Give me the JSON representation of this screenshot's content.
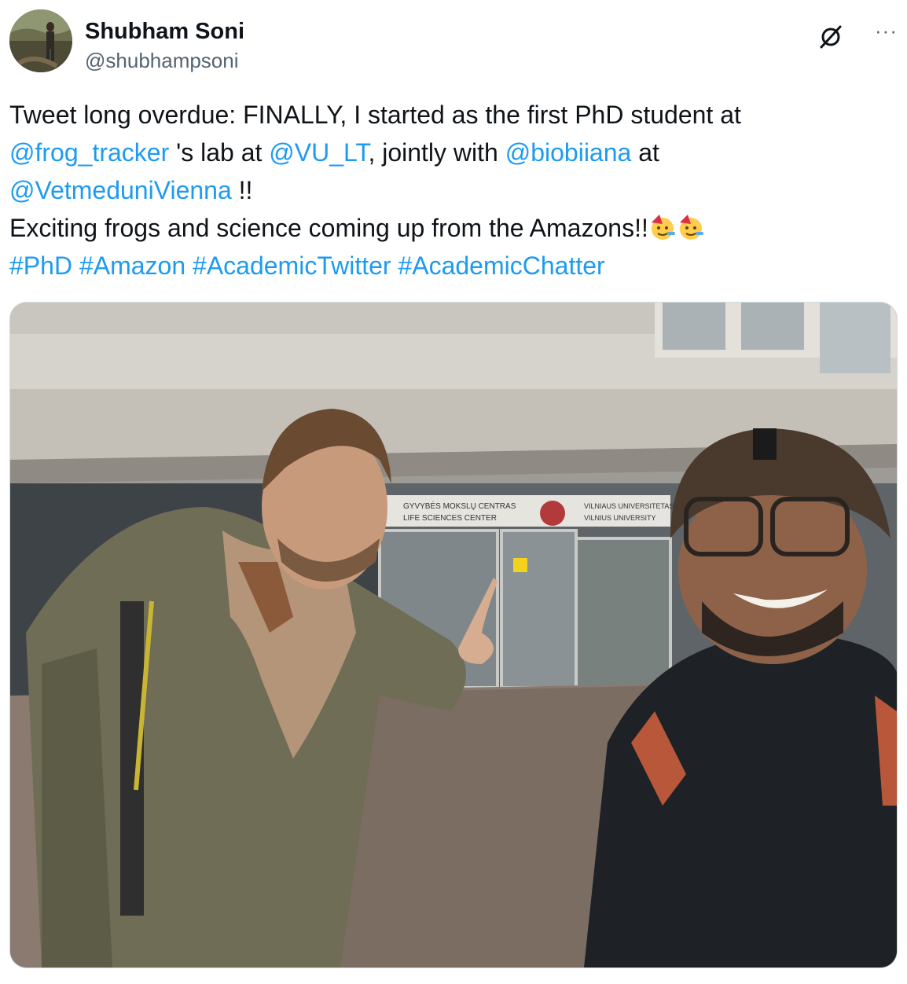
{
  "author": {
    "name": "Shubham Soni",
    "handle": "@shubhampsoni",
    "avatar_icon": "avatar-photo"
  },
  "actions": {
    "grok_icon": "grok-icon",
    "more_label": "···"
  },
  "tweet": {
    "line1": "Tweet long overdue: FINALLY, I started as the first PhD student at",
    "mention_frog": "@frog_tracker",
    "line2_mid1": " 's lab at ",
    "mention_vu": "@VU_LT",
    "line2_mid2": ", jointly with ",
    "mention_bio": "@biobiiana",
    "line2_end": " at",
    "mention_vet": "@VetmeduniVienna",
    "line3_end": " !!",
    "line4": "Exciting frogs and science coming up from the Amazons!!",
    "hashtags": [
      "#PhD",
      "#Amazon",
      "#AcademicTwitter",
      "#AcademicChatter"
    ]
  },
  "colors": {
    "link": "#1d9bf0",
    "text": "#0f1419",
    "muted": "#536471",
    "border": "#cfd9de"
  },
  "media": {
    "photo_icon": "selfie-photo",
    "sign_line1": "GYVYBĖS MOKSLŲ CENTRAS",
    "sign_line2": "LIFE SCIENCES CENTER",
    "sign_right1": "VILNIAUS UNIVERSITETAS",
    "sign_right2": "VILNIUS UNIVERSITY"
  }
}
